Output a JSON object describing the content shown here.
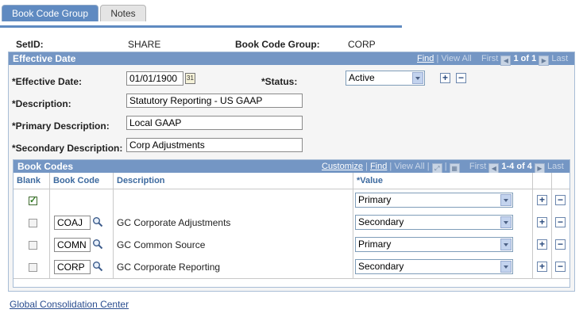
{
  "tabs": [
    {
      "label": "Book Code Group",
      "active": true
    },
    {
      "label": "Notes",
      "active": false
    }
  ],
  "header": {
    "setid_label": "SetID:",
    "setid_value": "SHARE",
    "group_label": "Book Code Group:",
    "group_value": "CORP"
  },
  "effective": {
    "title": "Effective Date",
    "nav": {
      "find": "Find",
      "view_all": "View All",
      "first": "First",
      "count": "1 of 1",
      "last": "Last"
    },
    "eff_date_label": "*Effective Date:",
    "eff_date_value": "01/01/1900",
    "status_label": "*Status:",
    "status_value": "Active",
    "description_label": "*Description:",
    "description_value": "Statutory Reporting - US GAAP",
    "primary_label": "*Primary Description:",
    "primary_value": "Local GAAP",
    "secondary_label": "*Secondary Description:",
    "secondary_value": "Corp Adjustments"
  },
  "book_codes": {
    "title": "Book Codes",
    "nav": {
      "customize": "Customize",
      "find": "Find",
      "view_all": "View All",
      "first": "First",
      "count": "1-4 of 4",
      "last": "Last"
    },
    "columns": [
      "Blank",
      "Book Code",
      "Description",
      "*Value"
    ],
    "rows": [
      {
        "blank": true,
        "code": "",
        "description": "",
        "value": "Primary"
      },
      {
        "blank": false,
        "code": "COAJ",
        "description": "GC Corporate Adjustments",
        "value": "Secondary"
      },
      {
        "blank": false,
        "code": "COMN",
        "description": "GC Common Source",
        "value": "Primary"
      },
      {
        "blank": false,
        "code": "CORP",
        "description": "GC Corporate Reporting",
        "value": "Secondary"
      }
    ]
  },
  "footer": {
    "link": "Global Consolidation Center"
  },
  "icons": {
    "calendar": "calendar-icon",
    "lookup": "magnifier-icon",
    "add": "plus-icon",
    "delete": "minus-icon"
  }
}
